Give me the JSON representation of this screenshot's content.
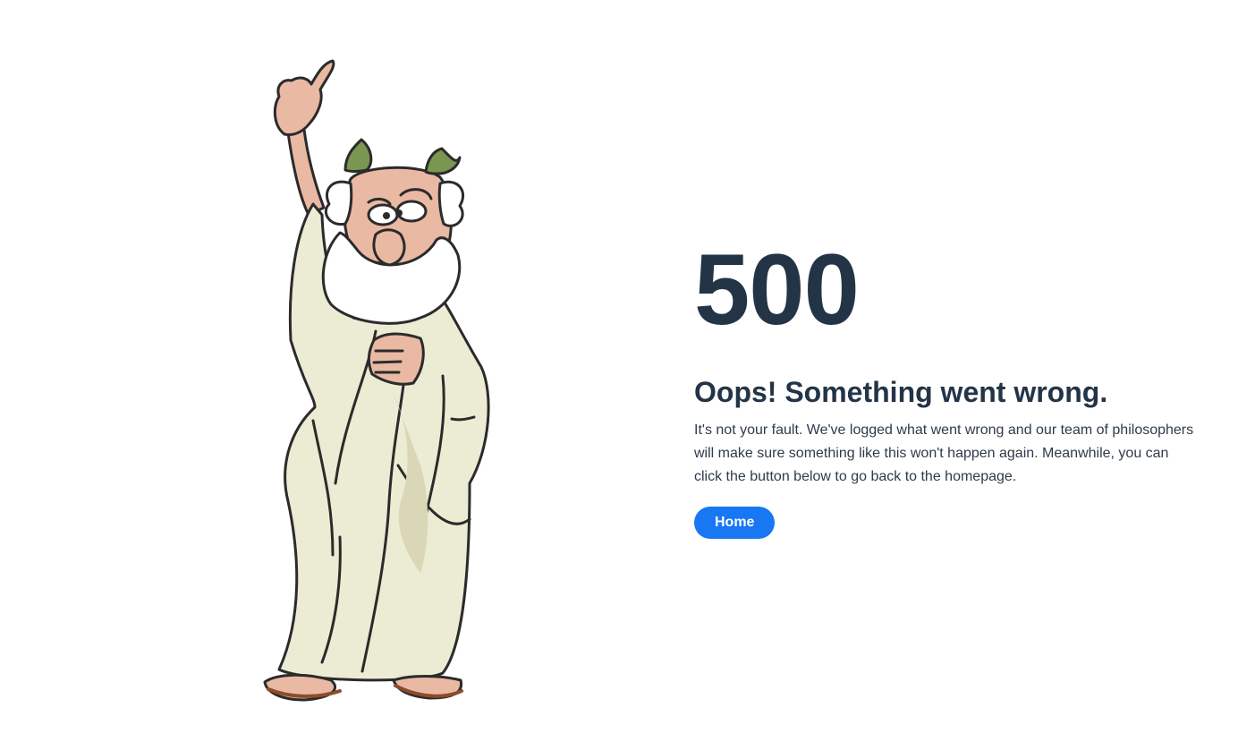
{
  "error": {
    "code": "500",
    "headline": "Oops! Something went wrong.",
    "message": "It's not your fault. We've logged what went wrong and our team of philosophers will make sure something like this won't happen again. Meanwhile, you can click the button below to go back to the homepage."
  },
  "actions": {
    "home_label": "Home"
  },
  "illustration": {
    "subject": "philosopher-thumbs-up-illustration"
  },
  "colors": {
    "background": "#ffffff",
    "text_dark": "#243447",
    "button": "#1877f2",
    "button_text": "#ffffff",
    "toga": "#ecebd4",
    "skin": "#eab9a3",
    "leaf": "#7a9651",
    "sandal": "#8a4d2a"
  }
}
